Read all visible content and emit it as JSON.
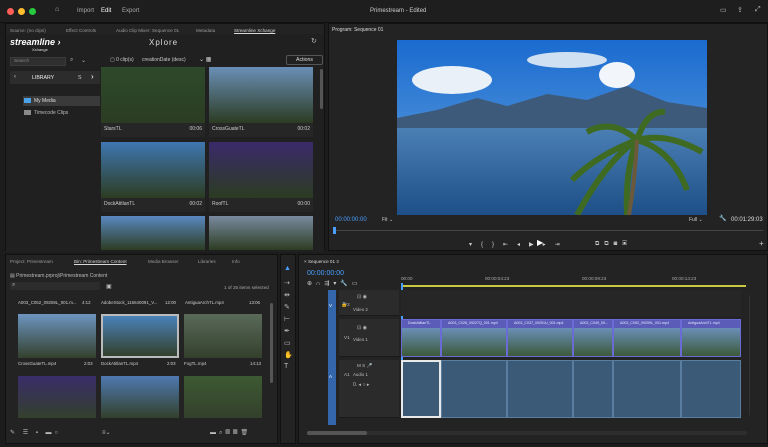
{
  "topbar": {
    "menu": [
      "Import",
      "Edit",
      "Export"
    ],
    "title": "Primestream",
    "subtitle": "Edited"
  },
  "source_panel": {
    "tabs": [
      "Source: (no clips)",
      "Effect Controls",
      "Audio Clip Mixer: Sequence 01",
      "Metadata",
      "Streamline Xchange"
    ],
    "logo_main": "streamline",
    "logo_sub": "Xchange",
    "header": "Xplore",
    "search_placeholder": "Search",
    "clip_count": "0 clip(s)",
    "sort": "creationDate (desc)",
    "actions": "Actions",
    "library_label": "LIBRARY",
    "s_label": "S",
    "folders": [
      "My Media",
      "Timecode Clips"
    ],
    "thumbs": [
      {
        "name": "StarsTL",
        "dur": "00:06",
        "color": "#2d4a2a"
      },
      {
        "name": "CrossGuateTL",
        "dur": "00:02",
        "color": "#6a8fb7"
      },
      {
        "name": "DockAtitlanTL",
        "dur": "00:02",
        "color": "#3f77b0"
      },
      {
        "name": "RoofTL",
        "dur": "00:00",
        "color": "#3a2a6a"
      },
      {
        "name": "",
        "dur": "",
        "color": "#5a88c0"
      },
      {
        "name": "",
        "dur": "",
        "color": "#7a8aa0"
      }
    ]
  },
  "program": {
    "title": "Program: Sequence 01",
    "timecode": "00:00:00:00",
    "fit": "Fit",
    "full": "Full",
    "duration": "00:01:29:03"
  },
  "project_panel": {
    "tabs": [
      "Project: Primestream",
      "Bin: Primestream Content",
      "Media Browser",
      "Libraries",
      "Info"
    ],
    "path": "Primestream.prproj\\Primestream Content",
    "items_selected": "1 of 25 items selected",
    "row1": [
      {
        "name": "A003_C052_09259L_001.m...",
        "dur": "4:12"
      },
      {
        "name": "AdobeStock_116640091_V...",
        "dur": "12:00"
      },
      {
        "name": "AntiguaArchTL.mp4",
        "dur": "13:06"
      }
    ],
    "clips": [
      {
        "name": "CrossGuateTL.mp4",
        "dur": "2:03",
        "color": "#6d95c0"
      },
      {
        "name": "DockAtitlanTL.mp4",
        "dur": "2:03",
        "color": "#4a82b8"
      },
      {
        "name": "FogTL.mp4",
        "dur": "14:13",
        "color": "#5a6a5a"
      },
      {
        "name": "",
        "dur": "",
        "color": "#3a2d6a"
      },
      {
        "name": "",
        "dur": "",
        "color": "#4f7ab0"
      },
      {
        "name": "",
        "dur": "",
        "color": "#3d5a32"
      }
    ]
  },
  "timeline": {
    "tab": "Sequence 01",
    "timecode": "00:00:00:00",
    "ruler": [
      "00:00",
      "00:00:04:23",
      "00:00:09:23",
      "00:00:14:23"
    ],
    "tracks": {
      "v2": "V2",
      "v1": "V1",
      "a1": "A1",
      "video2": "Video 2",
      "video1": "Video 1",
      "audio1": "Audio 1",
      "v": "V",
      "a": "A"
    },
    "clips": [
      "DockAtitlanTL",
      "A003_C026_09227Q_001.mp4",
      "A003_C037_09251U_001.mp4",
      "A003_C049_09...",
      "A003_C052_09259L_001.mp4",
      "AntiguaArchTL.mp4"
    ]
  },
  "icons": [
    "home-icon",
    "search-icon",
    "refresh-icon",
    "play-icon",
    "wrench-icon",
    "arrow-tool-icon",
    "hand-icon",
    "type-icon"
  ]
}
